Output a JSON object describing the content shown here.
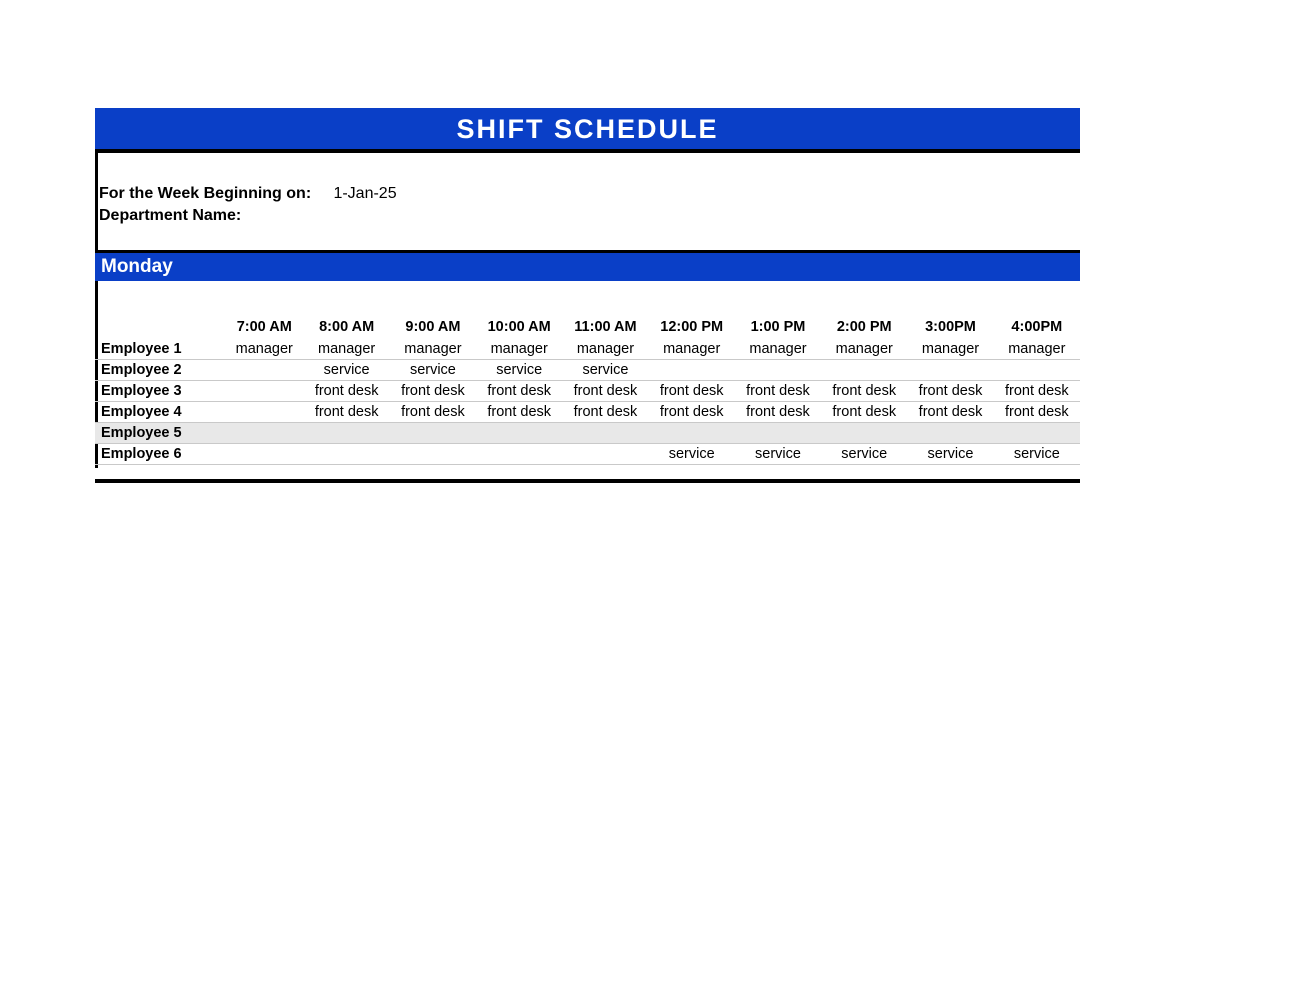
{
  "title": "SHIFT SCHEDULE",
  "meta": {
    "weekLabel": "For the Week Beginning on:",
    "weekValue": "1-Jan-25",
    "deptLabel": "Department Name:",
    "deptValue": ""
  },
  "day": "Monday",
  "times": [
    "7:00 AM",
    "8:00 AM",
    "9:00 AM",
    "10:00 AM",
    "11:00 AM",
    "12:00 PM",
    "1:00 PM",
    "2:00 PM",
    "3:00PM",
    "4:00PM"
  ],
  "employees": [
    {
      "name": "Employee 1",
      "cells": [
        "manager",
        "manager",
        "manager",
        "manager",
        "manager",
        "manager",
        "manager",
        "manager",
        "manager",
        "manager"
      ],
      "alt": false
    },
    {
      "name": "Employee 2",
      "cells": [
        "",
        "service",
        "service",
        "service",
        "service",
        "",
        "",
        "",
        "",
        ""
      ],
      "alt": false
    },
    {
      "name": "Employee 3",
      "cells": [
        "",
        "front desk",
        "front desk",
        "front desk",
        "front desk",
        "front desk",
        "front desk",
        "front desk",
        "front desk",
        "front desk"
      ],
      "alt": false
    },
    {
      "name": "Employee 4",
      "cells": [
        "",
        "front desk",
        "front desk",
        "front desk",
        "front desk",
        "front desk",
        "front desk",
        "front desk",
        "front desk",
        "front desk"
      ],
      "alt": false
    },
    {
      "name": "Employee 5",
      "cells": [
        "",
        "",
        "",
        "",
        "",
        "",
        "",
        "",
        "",
        ""
      ],
      "alt": true
    },
    {
      "name": "Employee 6",
      "cells": [
        "",
        "",
        "",
        "",
        "",
        "service",
        "service",
        "service",
        "service",
        "service"
      ],
      "alt": false
    }
  ]
}
